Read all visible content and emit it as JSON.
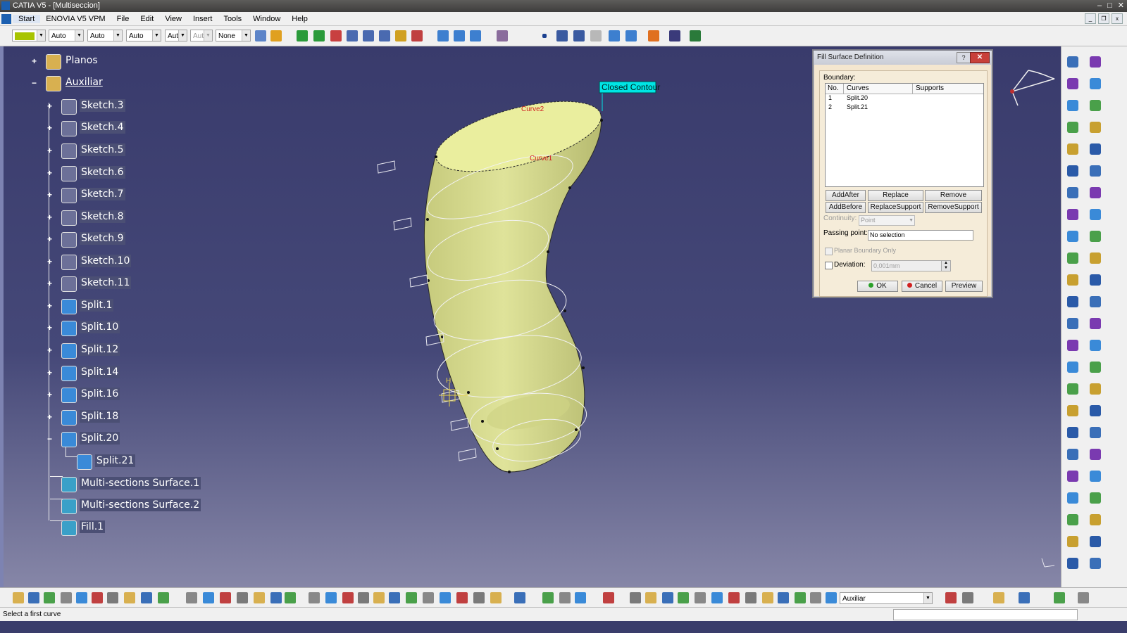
{
  "window": {
    "title": "CATIA V5 - [Multiseccion]",
    "controls": [
      "–",
      "□",
      "✕"
    ]
  },
  "menu": {
    "items": [
      "Start",
      "ENOVIA V5 VPM",
      "File",
      "Edit",
      "View",
      "Insert",
      "Tools",
      "Window",
      "Help"
    ]
  },
  "toolbar": {
    "combo_color": "",
    "combo_linetype": "Auto",
    "combo_thickness": "Auto",
    "combo_layer": "Auto",
    "combo_aut1": "Aut",
    "combo_aut2": "Aut",
    "combo_none": "None"
  },
  "tree": {
    "items": [
      {
        "label": "Planos",
        "icon": "plane-folder-icon"
      },
      {
        "label": "Auxiliar",
        "icon": "geometrical-set-icon"
      },
      {
        "label": "Sketch.3",
        "icon": "sketch-icon"
      },
      {
        "label": "Sketch.4",
        "icon": "sketch-icon"
      },
      {
        "label": "Sketch.5",
        "icon": "sketch-icon"
      },
      {
        "label": "Sketch.6",
        "icon": "sketch-icon"
      },
      {
        "label": "Sketch.7",
        "icon": "sketch-icon"
      },
      {
        "label": "Sketch.8",
        "icon": "sketch-icon"
      },
      {
        "label": "Sketch.9",
        "icon": "sketch-icon"
      },
      {
        "label": "Sketch.10",
        "icon": "sketch-icon"
      },
      {
        "label": "Sketch.11",
        "icon": "sketch-icon"
      },
      {
        "label": "Split.1",
        "icon": "split-icon"
      },
      {
        "label": "Split.10",
        "icon": "split-icon"
      },
      {
        "label": "Split.12",
        "icon": "split-icon"
      },
      {
        "label": "Split.14",
        "icon": "split-icon"
      },
      {
        "label": "Split.16",
        "icon": "split-icon"
      },
      {
        "label": "Split.18",
        "icon": "split-icon"
      },
      {
        "label": "Split.20",
        "icon": "split-icon"
      },
      {
        "label": "Split.21",
        "icon": "split-icon"
      },
      {
        "label": "Multi-sections Surface.1",
        "icon": "multisection-surface-icon"
      },
      {
        "label": "Multi-sections Surface.2",
        "icon": "multisection-surface-icon"
      },
      {
        "label": "Fill.1",
        "icon": "fill-surface-icon"
      }
    ]
  },
  "viewport": {
    "closed_contour_label": "Closed Contour",
    "curve1_label": "Curve1",
    "curve2_label": "Curve2",
    "point_label": "H"
  },
  "dialog": {
    "title": "Fill Surface Definition",
    "help_btn": "?",
    "close_btn": "✕",
    "boundary_label": "Boundary:",
    "columns": [
      "No.",
      "Curves",
      "Supports"
    ],
    "rows": [
      {
        "no": "1",
        "curve": "Split.20",
        "support": ""
      },
      {
        "no": "2",
        "curve": "Split.21",
        "support": ""
      }
    ],
    "buttons_row1": [
      "AddAfter",
      "Replace",
      "Remove"
    ],
    "buttons_row2": [
      "AddBefore",
      "ReplaceSupport",
      "RemoveSupport"
    ],
    "continuity_label": "Continuity:",
    "continuity_value": "Point",
    "passing_point_label": "Passing point:",
    "passing_point_value": "No selection",
    "planar_label": "Planar Boundary Only",
    "deviation_label": "Deviation:",
    "deviation_value": "0,001mm",
    "ok": "OK",
    "cancel": "Cancel",
    "preview": "Preview"
  },
  "bottom": {
    "layer_combo": "Auxiliar"
  },
  "status": {
    "message": "Select a first curve"
  },
  "colors": {
    "surface": "#d9dd8e",
    "viewport_top": "#393b6c",
    "label_bg": "#00e5e5"
  }
}
